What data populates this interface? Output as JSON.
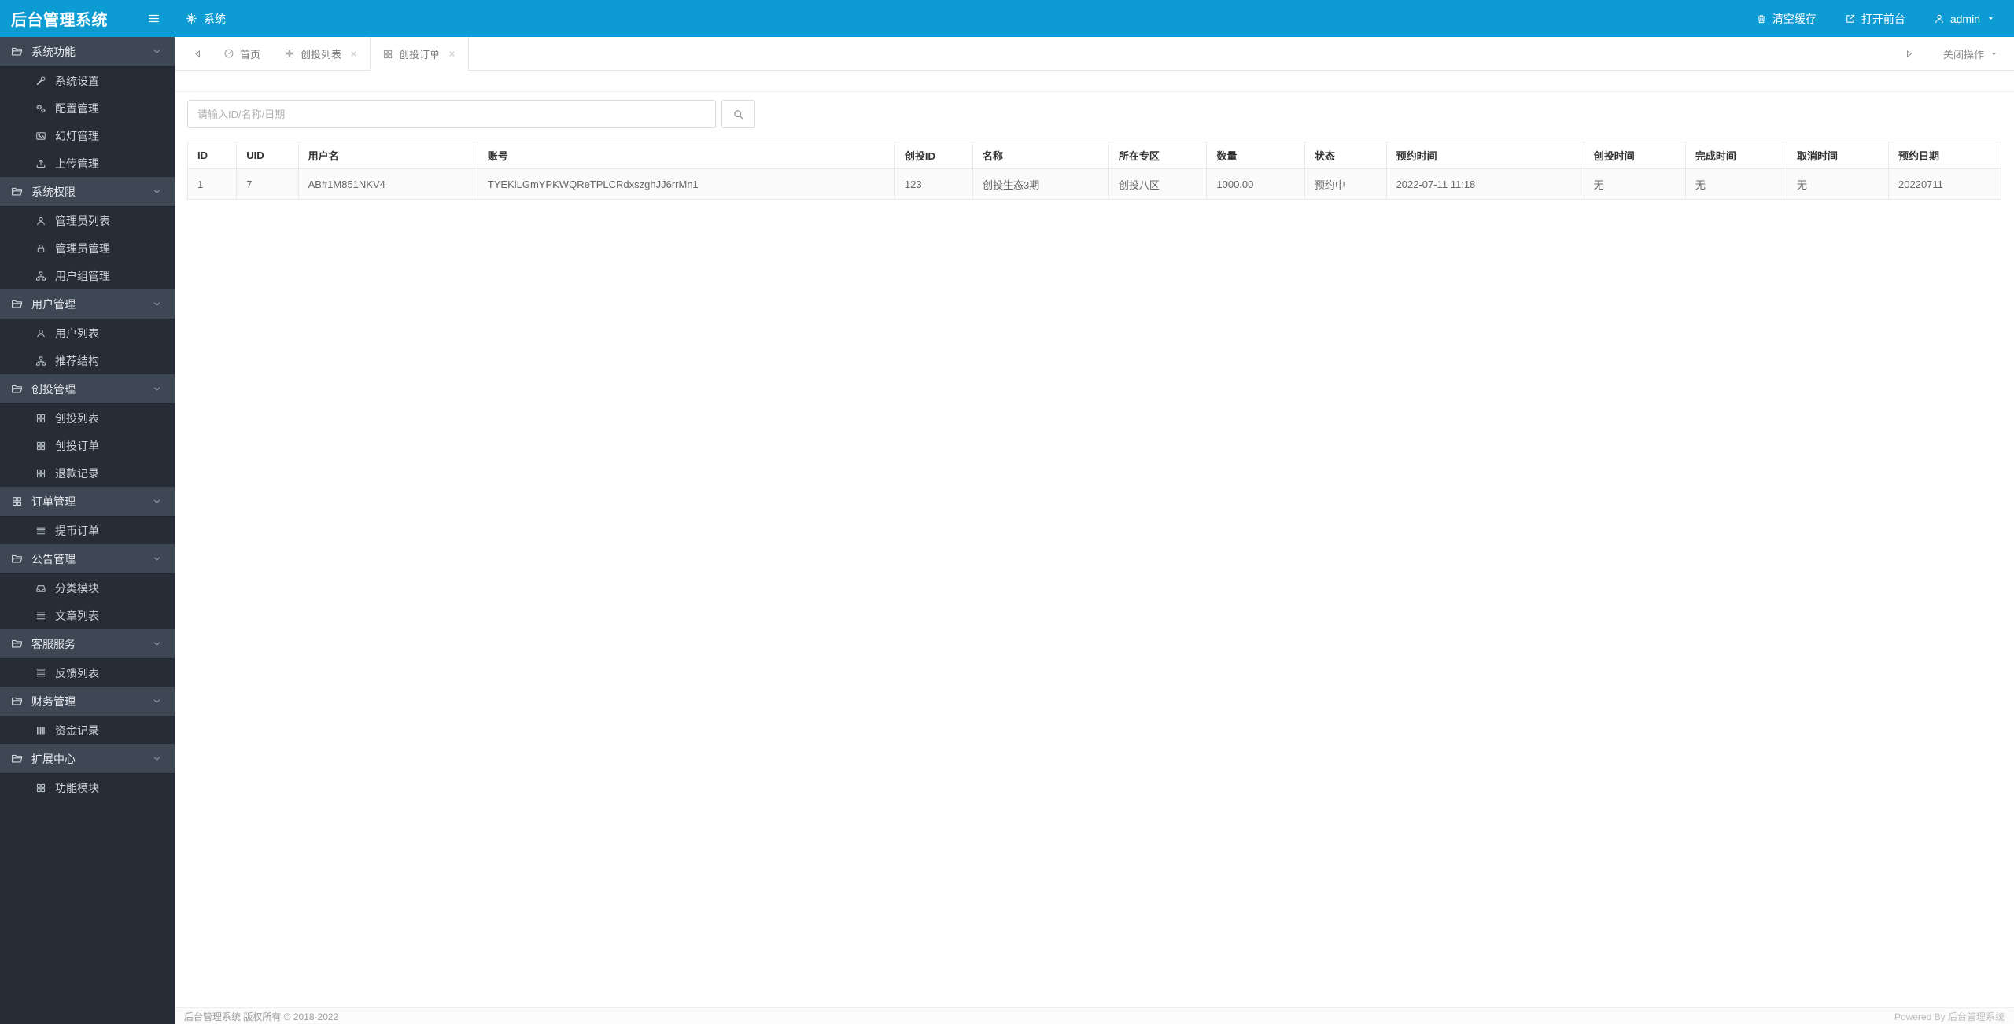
{
  "app": {
    "title": "后台管理系统"
  },
  "topbar": {
    "system_label": "系统",
    "clear_cache_label": "清空缓存",
    "open_frontend_label": "打开前台",
    "username": "admin"
  },
  "tabs": {
    "scroll_left_icon": "tri-left",
    "scroll_right_icon": "tri-right",
    "close_menu_label": "关闭操作",
    "items": [
      {
        "label": "首页",
        "icon": "dashboard",
        "closable": false,
        "active": false
      },
      {
        "label": "创投列表",
        "icon": "grid",
        "closable": true,
        "active": false
      },
      {
        "label": "创投订单",
        "icon": "grid",
        "closable": true,
        "active": true
      }
    ]
  },
  "sidebar": {
    "groups": [
      {
        "label": "系统功能",
        "icon": "folder",
        "items": [
          {
            "label": "系统设置",
            "icon": "wrench"
          },
          {
            "label": "配置管理",
            "icon": "gears"
          },
          {
            "label": "幻灯管理",
            "icon": "image"
          },
          {
            "label": "上传管理",
            "icon": "upload"
          }
        ]
      },
      {
        "label": "系统权限",
        "icon": "folder",
        "items": [
          {
            "label": "管理员列表",
            "icon": "user"
          },
          {
            "label": "管理员管理",
            "icon": "lock"
          },
          {
            "label": "用户组管理",
            "icon": "sitemap"
          }
        ]
      },
      {
        "label": "用户管理",
        "icon": "folder",
        "items": [
          {
            "label": "用户列表",
            "icon": "user"
          },
          {
            "label": "推荐结构",
            "icon": "sitemap"
          }
        ]
      },
      {
        "label": "创投管理",
        "icon": "folder",
        "items": [
          {
            "label": "创投列表",
            "icon": "grid"
          },
          {
            "label": "创投订单",
            "icon": "grid"
          },
          {
            "label": "退款记录",
            "icon": "grid"
          }
        ]
      },
      {
        "label": "订单管理",
        "icon": "grid",
        "items": [
          {
            "label": "提币订单",
            "icon": "list"
          }
        ]
      },
      {
        "label": "公告管理",
        "icon": "folder",
        "items": [
          {
            "label": "分类模块",
            "icon": "inbox"
          },
          {
            "label": "文章列表",
            "icon": "list"
          }
        ]
      },
      {
        "label": "客服服务",
        "icon": "folder",
        "items": [
          {
            "label": "反馈列表",
            "icon": "list"
          }
        ]
      },
      {
        "label": "财务管理",
        "icon": "folder",
        "items": [
          {
            "label": "资金记录",
            "icon": "barcode"
          }
        ]
      },
      {
        "label": "扩展中心",
        "icon": "folder",
        "items": [
          {
            "label": "功能模块",
            "icon": "grid"
          }
        ]
      }
    ]
  },
  "search": {
    "placeholder": "请输入ID/名称/日期",
    "button_icon": "search"
  },
  "table": {
    "columns": [
      "ID",
      "UID",
      "用户名",
      "账号",
      "创投ID",
      "名称",
      "所在专区",
      "数量",
      "状态",
      "预约时间",
      "创投时间",
      "完成时间",
      "取消时间",
      "预约日期"
    ],
    "rows": [
      {
        "id": "1",
        "uid": "7",
        "username": "AB#1M851NKV4",
        "account": "TYEKiLGmYPKWQReTPLCRdxszghJJ6rrMn1",
        "invest_id": "123",
        "name": "创投生态3期",
        "zone": "创投八区",
        "amount": "1000.00",
        "status": "预约中",
        "reserve_time": "2022-07-11 11:18",
        "invest_time": "无",
        "finish_time": "无",
        "cancel_time": "无",
        "reserve_date": "20220711"
      }
    ]
  },
  "footer": {
    "copyright": "后台管理系统 版权所有 © 2018-2022",
    "powered_by": "Powered By 后台管理系统"
  },
  "colors": {
    "topbar_bg": "#0c9bd3",
    "sidebar_bg": "#262d36",
    "sidebar_group_bg": "#3e4754",
    "status_link": "#3b3bd6"
  }
}
